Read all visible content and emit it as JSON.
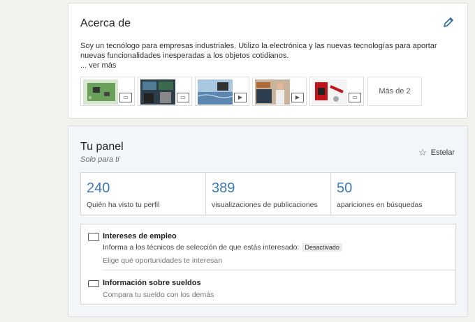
{
  "about": {
    "title": "Acerca de",
    "text": "Soy un tecnólogo para empresas industriales. Utilizo la electrónica y las nuevas tecnologías para aportar nuevas funcionalidades inesperadas a los objetos cotidianos.",
    "see_more": "... ver más",
    "media_icons": [
      "document-icon",
      "document-icon",
      "video-icon",
      "video-icon",
      "document-icon"
    ],
    "more_media": "Más de 2"
  },
  "panel": {
    "title": "Tu panel",
    "subtitle": "Solo para ti",
    "star_label": "Estelar",
    "stats": [
      {
        "value": "240",
        "label": "Quién ha visto tu perfil"
      },
      {
        "value": "389",
        "label": "visualizaciones de publicaciones"
      },
      {
        "value": "50",
        "label": "apariciones en búsquedas"
      }
    ],
    "job": {
      "title": "Intereses de empleo",
      "line": "Informa a los técnicos de selección de que estás interesado:",
      "badge": "Desactivado",
      "sub": "Elige qué oportunidades te interesan"
    },
    "salary": {
      "title": "Información sobre sueldos",
      "sub": "Compara tu sueldo con los demás"
    }
  },
  "colors": {
    "accent": "#3b7ab8",
    "page_bg": "#f3f2ef"
  }
}
